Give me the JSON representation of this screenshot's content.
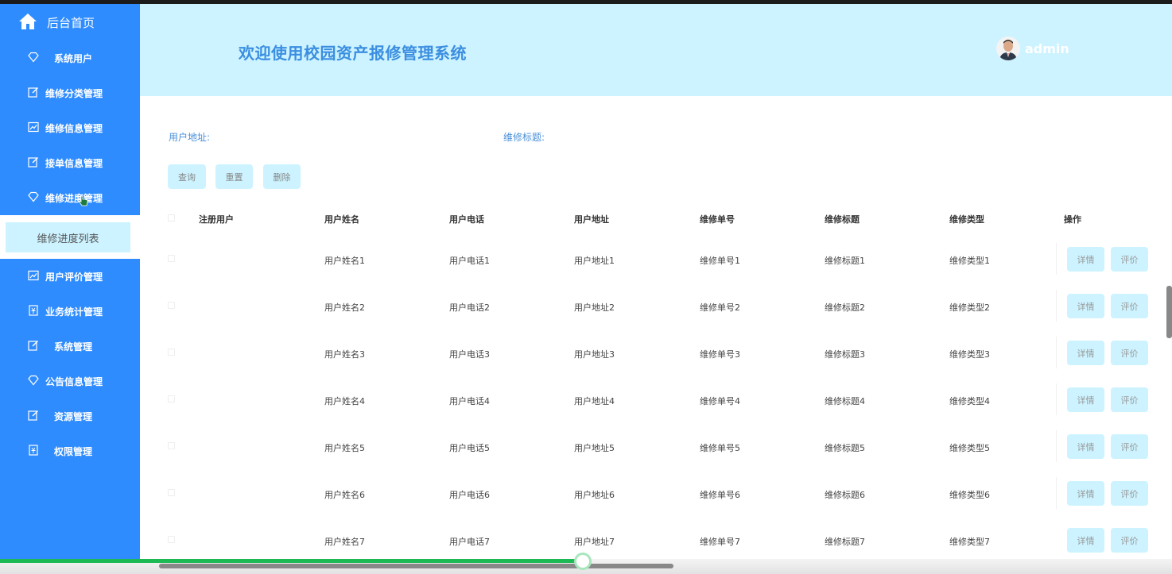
{
  "sidebar": {
    "home_label": "后台首页",
    "items": [
      {
        "label": "系统用户",
        "icon": "diamond-icon"
      },
      {
        "label": "维修分类管理",
        "icon": "edit-icon"
      },
      {
        "label": "维修信息管理",
        "icon": "chart-icon"
      },
      {
        "label": "接单信息管理",
        "icon": "edit-icon"
      },
      {
        "label": "维修进度管理",
        "icon": "diamond-icon"
      },
      {
        "label": "用户评价管理",
        "icon": "chart-icon"
      },
      {
        "label": "业务统计管理",
        "icon": "ticket-icon"
      },
      {
        "label": "系统管理",
        "icon": "edit-icon"
      },
      {
        "label": "公告信息管理",
        "icon": "diamond-icon"
      },
      {
        "label": "资源管理",
        "icon": "edit-icon"
      },
      {
        "label": "权限管理",
        "icon": "ticket-icon"
      }
    ],
    "active_sub_label": "维修进度列表",
    "colors": {
      "bg": "#2f8cff",
      "active_sub": "#ccf3ff"
    }
  },
  "header": {
    "title": "欢迎使用校园资产报修管理系统",
    "user": "admin",
    "bg": "#ccf3ff"
  },
  "search": {
    "address_label": "用户地址:",
    "title_label": "维修标题:"
  },
  "buttons": {
    "query": "查询",
    "reset": "重置",
    "delete": "删除"
  },
  "table": {
    "columns": [
      "注册用户",
      "用户姓名",
      "用户电话",
      "用户地址",
      "维修单号",
      "维修标题",
      "维修类型",
      "操作"
    ],
    "rows": [
      [
        "",
        "用户姓名1",
        "用户电话1",
        "用户地址1",
        "维修单号1",
        "维修标题1",
        "维修类型1"
      ],
      [
        "",
        "用户姓名2",
        "用户电话2",
        "用户地址2",
        "维修单号2",
        "维修标题2",
        "维修类型2"
      ],
      [
        "",
        "用户姓名3",
        "用户电话3",
        "用户地址3",
        "维修单号3",
        "维修标题3",
        "维修类型3"
      ],
      [
        "",
        "用户姓名4",
        "用户电话4",
        "用户地址4",
        "维修单号4",
        "维修标题4",
        "维修类型4"
      ],
      [
        "",
        "用户姓名5",
        "用户电话5",
        "用户地址5",
        "维修单号5",
        "维修标题5",
        "维修类型5"
      ],
      [
        "",
        "用户姓名6",
        "用户电话6",
        "用户地址6",
        "维修单号6",
        "维修标题6",
        "维修类型6"
      ],
      [
        "",
        "用户姓名7",
        "用户电话7",
        "用户地址7",
        "维修单号7",
        "维修标题7",
        "维修类型7"
      ]
    ],
    "row_actions": [
      "详情",
      "评价"
    ]
  },
  "video": {
    "progress_fraction": 0.497
  }
}
